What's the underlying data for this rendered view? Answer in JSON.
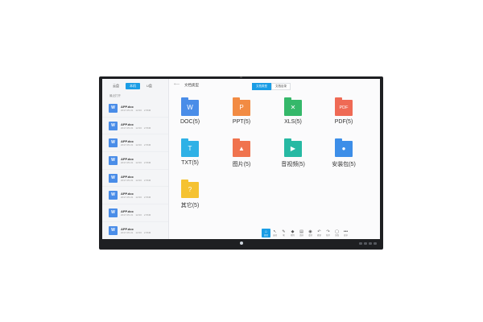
{
  "left_panel": {
    "tabs": [
      {
        "label": "云盘",
        "active": false
      },
      {
        "label": "本机",
        "active": true
      },
      {
        "label": "U盘",
        "active": false
      }
    ],
    "recent_label": "最近打开",
    "files": [
      {
        "name": "APP.doc",
        "date": "2017-05-31",
        "time": "12:00",
        "size": "2.56M"
      },
      {
        "name": "APP.doc",
        "date": "2017-05-31",
        "time": "12:00",
        "size": "2.56M"
      },
      {
        "name": "APP.doc",
        "date": "2017-05-31",
        "time": "12:00",
        "size": "2.56M"
      },
      {
        "name": "APP.doc",
        "date": "2017-05-31",
        "time": "12:00",
        "size": "2.56M"
      },
      {
        "name": "APP.doc",
        "date": "2017-05-31",
        "time": "12:00",
        "size": "2.56M"
      },
      {
        "name": "APP.doc",
        "date": "2017-05-31",
        "time": "12:00",
        "size": "2.56M"
      },
      {
        "name": "APP.doc",
        "date": "2017-05-31",
        "time": "12:00",
        "size": "2.56M"
      },
      {
        "name": "APP.doc",
        "date": "2017-05-31",
        "time": "12:00",
        "size": "2.56M"
      }
    ],
    "file_icon_letter": "W"
  },
  "toolbar": {
    "title": "文档类型",
    "back_icon": "back-arrow-icon",
    "segments": [
      {
        "label": "文档类型",
        "active": true
      },
      {
        "label": "文档目录",
        "active": false
      }
    ]
  },
  "categories": [
    {
      "label": "DOC(5)",
      "glyph": "W",
      "color": "#4a8de8",
      "icon": "doc-icon"
    },
    {
      "label": "PPT(5)",
      "glyph": "P",
      "color": "#f28b43",
      "icon": "ppt-icon"
    },
    {
      "label": "XLS(5)",
      "glyph": "✕",
      "color": "#35b86a",
      "icon": "xls-icon"
    },
    {
      "label": "PDF(5)",
      "glyph": "PDF",
      "color": "#ef6a55",
      "icon": "pdf-icon"
    },
    {
      "label": "TXT(5)",
      "glyph": "T",
      "color": "#2fb1e6",
      "icon": "txt-icon"
    },
    {
      "label": "图片(5)",
      "glyph": "▲",
      "color": "#f0734e",
      "icon": "image-icon"
    },
    {
      "label": "音视频(5)",
      "glyph": "▶",
      "color": "#26b9a3",
      "icon": "media-icon"
    },
    {
      "label": "安装包(5)",
      "glyph": "●",
      "color": "#3d8ee8",
      "icon": "android-icon"
    },
    {
      "label": "其它(5)",
      "glyph": "?",
      "color": "#f5c231",
      "icon": "other-icon"
    }
  ],
  "dock": [
    {
      "glyph": "⌂",
      "label": "首页",
      "icon": "home-icon",
      "active": true
    },
    {
      "glyph": "↖",
      "label": "选择",
      "icon": "pointer-icon",
      "active": false
    },
    {
      "glyph": "✎",
      "label": "笔",
      "icon": "pen-icon",
      "active": false
    },
    {
      "glyph": "◆",
      "label": "擦除",
      "icon": "eraser-icon",
      "active": false
    },
    {
      "glyph": "▤",
      "label": "清屏",
      "icon": "clear-icon",
      "active": false
    },
    {
      "glyph": "◉",
      "label": "漫游",
      "icon": "roam-icon",
      "active": false
    },
    {
      "glyph": "↶",
      "label": "撤销",
      "icon": "undo-icon",
      "active": false
    },
    {
      "glyph": "↷",
      "label": "恢复",
      "icon": "redo-icon",
      "active": false
    },
    {
      "glyph": "▢",
      "label": "页面",
      "icon": "page-icon",
      "active": false
    },
    {
      "glyph": "•••",
      "label": "更多",
      "icon": "more-icon",
      "active": false
    }
  ]
}
